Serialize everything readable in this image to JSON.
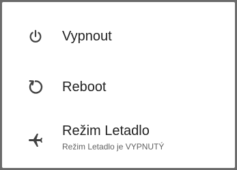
{
  "power_menu": {
    "items": [
      {
        "label": "Vypnout",
        "icon": "power-icon"
      },
      {
        "label": "Reboot",
        "icon": "restart-icon"
      },
      {
        "label": "Režim Letadlo",
        "sublabel": "Režim Letadlo je VYPNUTÝ",
        "icon": "airplane-icon"
      }
    ],
    "icon_color": "#424242",
    "text_color": "#212121",
    "secondary_text_color": "#616161",
    "scrim_color": "#6b6b6b"
  }
}
